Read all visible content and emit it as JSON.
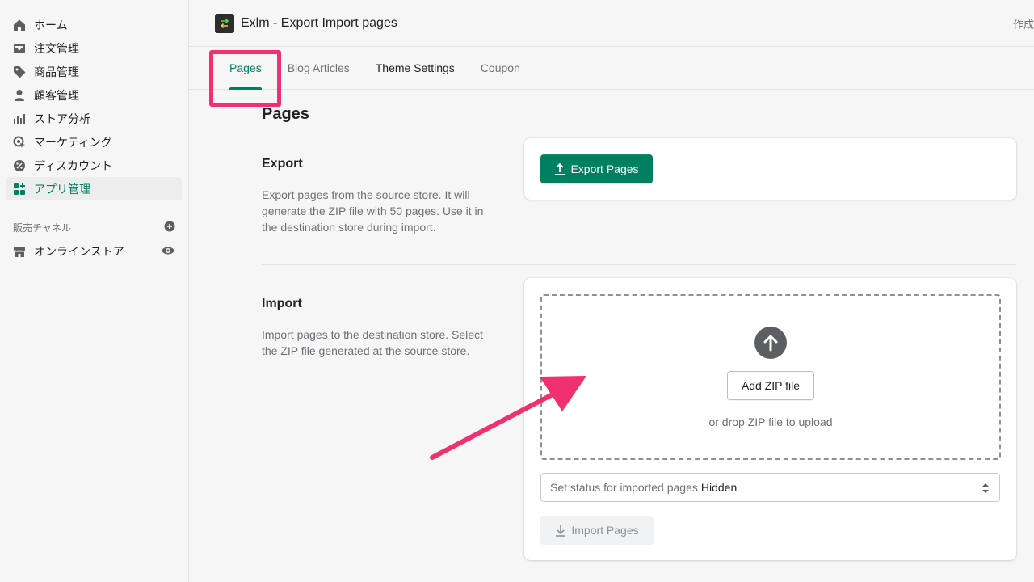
{
  "sidebar": {
    "items": [
      {
        "label": "ホーム",
        "icon": "home-icon"
      },
      {
        "label": "注文管理",
        "icon": "inbox-icon"
      },
      {
        "label": "商品管理",
        "icon": "tag-icon"
      },
      {
        "label": "顧客管理",
        "icon": "person-icon"
      },
      {
        "label": "ストア分析",
        "icon": "bar-chart-icon"
      },
      {
        "label": "マーケティング",
        "icon": "target-icon"
      },
      {
        "label": "ディスカウント",
        "icon": "discount-icon"
      },
      {
        "label": "アプリ管理",
        "icon": "apps-icon"
      }
    ],
    "sales_channels_label": "販売チャネル",
    "channels": [
      {
        "label": "オンラインストア",
        "icon": "store-icon"
      }
    ]
  },
  "header": {
    "app_title": "Exlm - Export Import pages",
    "right_text": "作成"
  },
  "tabs": [
    {
      "label": "Pages"
    },
    {
      "label": "Blog Articles"
    },
    {
      "label": "Theme Settings"
    },
    {
      "label": "Coupon"
    }
  ],
  "main": {
    "page_title": "Pages",
    "export": {
      "title": "Export",
      "description": "Export pages from the source store. It will generate the ZIP file with 50 pages. Use it in the destination store during import.",
      "button_label": "Export Pages"
    },
    "import": {
      "title": "Import",
      "description": "Import pages to the destination store. Select the ZIP file generated at the source store.",
      "add_button_label": "Add ZIP file",
      "drop_hint": "or drop ZIP file to upload",
      "status_label": "Set status for imported pages",
      "status_value": "Hidden",
      "import_button_label": "Import Pages"
    }
  },
  "colors": {
    "accent": "#008060",
    "annotation": "#f0306f"
  }
}
